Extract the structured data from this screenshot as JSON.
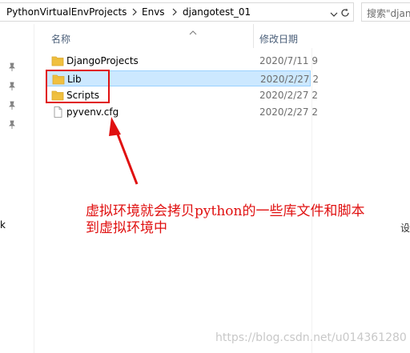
{
  "address_bar": {
    "crumbs": [
      "PythonVirtualEnvProjects",
      "Envs",
      "djangotest_01"
    ],
    "search_placeholder": "搜索\"djan"
  },
  "nav": {
    "partial_label": "k"
  },
  "columns": {
    "name": "名称",
    "date_modified": "修改日期"
  },
  "files": [
    {
      "name": "DjangoProjects",
      "date": "2020/7/11 9",
      "type": "folder",
      "selected": false
    },
    {
      "name": "Lib",
      "date": "2020/2/27 2",
      "type": "folder",
      "selected": true
    },
    {
      "name": "Scripts",
      "date": "2020/2/27 2",
      "type": "folder",
      "selected": false
    },
    {
      "name": "pyvenv.cfg",
      "date": "2020/2/27 2",
      "type": "file",
      "selected": false
    }
  ],
  "annotation": {
    "line1": "虚拟环境就会拷贝python的一些库文件和脚本",
    "line2": "到虚拟环境中",
    "color": "#e01010"
  },
  "side_text": "设",
  "watermark": "https://blog.csdn.net/u014361280",
  "icons": {
    "folder": "folder-icon",
    "file": "file-icon",
    "pin": "pin-icon",
    "refresh": "refresh-icon",
    "dropdown": "chevron-down-icon",
    "sort": "sort-up-icon"
  },
  "colors": {
    "selection_bg": "#cce8ff",
    "selection_border": "#99d1ff",
    "folder": "#f0c040"
  }
}
